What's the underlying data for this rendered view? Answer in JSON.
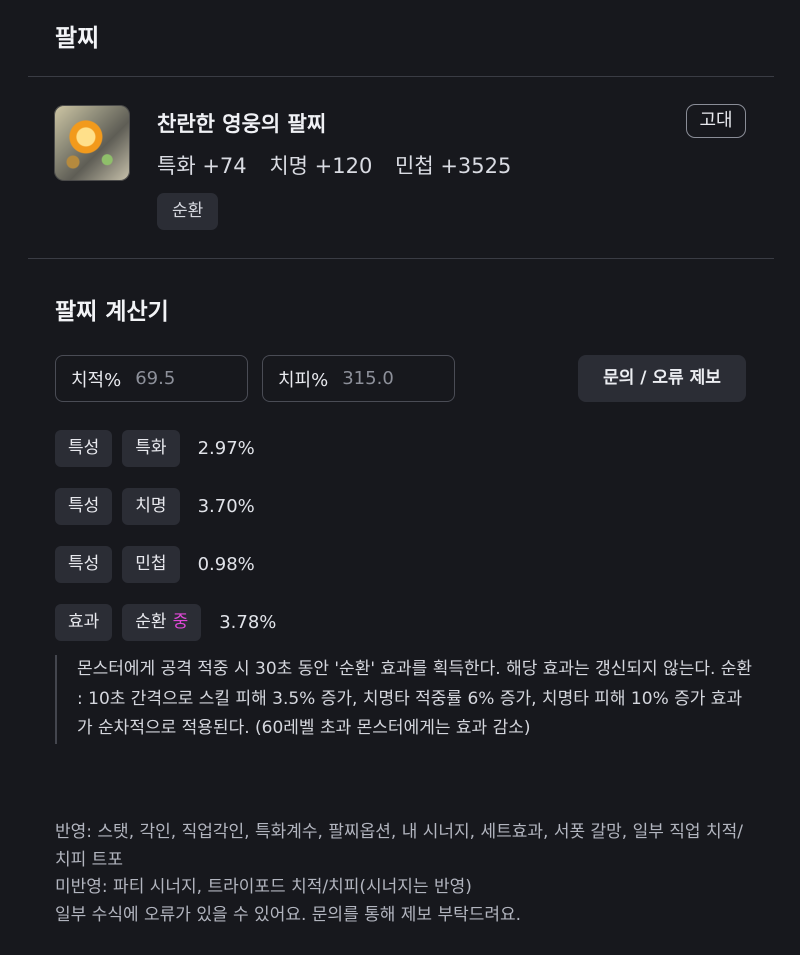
{
  "header": {
    "title": "팔찌"
  },
  "item": {
    "name": "찬란한 영웅의 팔찌",
    "grade": "고대",
    "stats": [
      "특화 +74",
      "치명 +120",
      "민첩 +3525"
    ],
    "tag": "순환",
    "icon": "bracelet-icon"
  },
  "calculator": {
    "title": "팔찌 계산기",
    "crit_rate": {
      "label": "치적%",
      "value": "69.5"
    },
    "crit_damage": {
      "label": "치피%",
      "value": "315.0"
    },
    "report_button": "문의 / 오류 제보",
    "rows": [
      {
        "type": "특성",
        "name": "특화",
        "value": "2.97%"
      },
      {
        "type": "특성",
        "name": "치명",
        "value": "3.70%"
      },
      {
        "type": "특성",
        "name": "민첩",
        "value": "0.98%"
      },
      {
        "type": "효과",
        "name": "순환",
        "badge": "중",
        "value": "3.78%"
      }
    ],
    "effect_description": "몬스터에게 공격 적중 시 30초 동안 '순환' 효과를 획득한다. 해당 효과는 갱신되지 않는다. 순환 : 10초 간격으로 스킬 피해 3.5% 증가, 치명타 적중률 6% 증가, 치명타 피해 10% 증가 효과가 순차적으로 적용된다. (60레벨 초과 몬스터에게는 효과 감소)"
  },
  "notes": {
    "applied": "반영: 스탯, 각인, 직업각인, 특화계수, 팔찌옵션, 내 시너지, 세트효과, 서폿 갈망, 일부 직업 치적/치피 트포",
    "not_applied": "미반영: 파티 시너지, 트라이포드 치적/치피(시너지는 반영)",
    "disclaimer": "일부 수식에 오류가 있을 수 있어요. 문의를 통해 제보 부탁드려요."
  },
  "colors": {
    "background": "#17181d",
    "chip": "#2b2d35",
    "highlight": "#e048d8"
  }
}
